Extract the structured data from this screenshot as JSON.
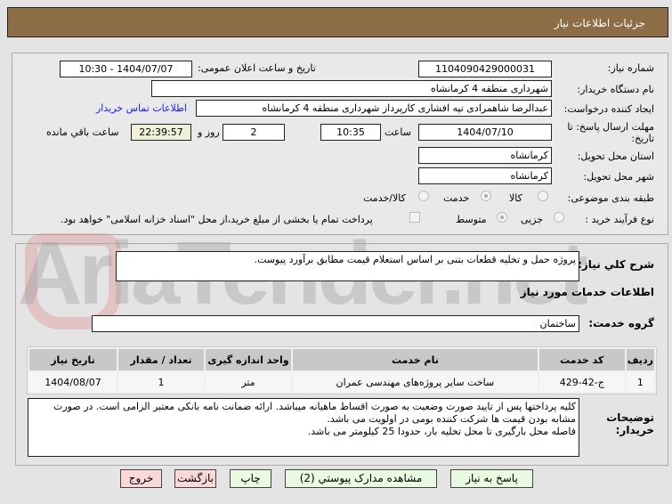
{
  "header": {
    "title": "جزئیات اطلاعات نیاز"
  },
  "watermark": "AriaTender.net",
  "form": {
    "need_number_label": "شماره نیاز:",
    "need_number": "1104090429000031",
    "announce_label": "تاریخ و ساعت اعلان عمومی:",
    "announce_value": "1404/07/07 - 10:30",
    "buyer_label": "نام دستگاه خریدار:",
    "buyer": "شهرداری منطقه 4 کرمانشاه",
    "creator_label": "ایجاد کننده درخواست:",
    "creator": "عبدالرضا شاهمرادی تپه افشاری کارپرداز شهرداری منطقه 4 کرمانشاه",
    "contact_link": "اطلاعات تماس خریدار",
    "deadline_label": "مهلت ارسال پاسخ: تا تاریخ:",
    "deadline_date": "1404/07/10",
    "time_label": "ساعت",
    "deadline_time": "10:35",
    "days": "2",
    "days_label": "روز و",
    "remaining": "22:39:57",
    "remaining_label": "ساعت باقي مانده",
    "province_label": "استان محل تحویل:",
    "province": "کرمانشاه",
    "city_label": "شهر محل تحویل:",
    "city": "کرمانشاه",
    "category_label": "طبقه بندی موضوعی:",
    "category_options": [
      "کالا",
      "خدمت",
      "کالا/خدمت"
    ],
    "category_selected": "خدمت",
    "process_label": "نوع فرآیند خرید :",
    "process_options": [
      "جزیی",
      "متوسط"
    ],
    "process_selected": "متوسط",
    "payment_note": "پرداخت تمام یا بخشی از مبلغ خرید،از محل \"اسناد خزانه اسلامی\" خواهد بود."
  },
  "details": {
    "desc_label": "شرح کلي نياز:",
    "desc": "پروژه حمل و تخلیه قطعات بتنی بر اساس استعلام قیمت مطابق برآورد پیوست.",
    "services_title": "اطلاعات خدمات مورد نیاز",
    "group_label": "گروه خدمت:",
    "group": "ساختمان",
    "table": {
      "headers": [
        "ردیف",
        "کد خدمت",
        "نام خدمت",
        "واحد اندازه گیری",
        "تعداد / مقدار",
        "تاریخ نیاز"
      ],
      "rows": [
        [
          "1",
          "ج-42-429",
          "ساخت سایر پروژه‌های مهندسی عمران",
          "متر",
          "1",
          "1404/08/07"
        ]
      ]
    },
    "notes_label": "توضیحات خریدار:",
    "notes": "کلیه پرداختها پس از تایید صورت وضعیت به صورت اقساط ماهیانه میباشد. ارائه ضمانت نامه بانکی معتبر الزامی است. در صورت مشابه بودن قیمت ها شرکت کننده بومی در اولویت می باشد.\nفاصله محل بارگیری تا محل تخلیه بار، حدودا 25 کیلومتر می باشد."
  },
  "buttons": {
    "reply": "پاسخ به نیاز",
    "attachments": "مشاهده مدارک پیوستي (2)",
    "print": "چاپ",
    "back": "بازگشت",
    "exit": "خروج"
  }
}
